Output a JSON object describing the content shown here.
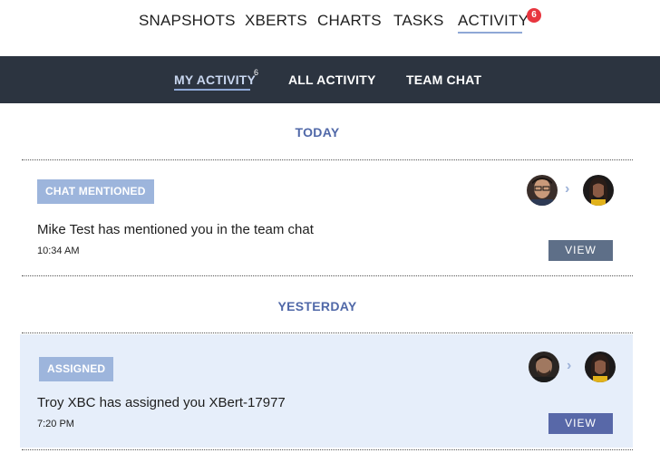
{
  "topnav": {
    "items": [
      "SNAPSHOTS",
      "XBERTS",
      "CHARTS",
      "TASKS",
      "ACTIVITY"
    ],
    "active": "ACTIVITY",
    "activity_badge": "6"
  },
  "subnav": {
    "items": [
      "MY ACTIVITY",
      "ALL ACTIVITY",
      "TEAM CHAT"
    ],
    "active": "MY ACTIVITY",
    "my_activity_count": "6"
  },
  "sections": [
    {
      "day": "TODAY",
      "entries": [
        {
          "tag": "CHAT MENTIONED",
          "message": "Mike Test has mentioned you in the team chat",
          "time": "10:34 AM",
          "button": "VIEW",
          "highlighted": false
        }
      ]
    },
    {
      "day": "YESTERDAY",
      "entries": [
        {
          "tag": "ASSIGNED",
          "message": "Troy XBC has assigned you XBert-17977",
          "time": "7:20 PM",
          "button": "VIEW",
          "highlighted": true
        }
      ]
    }
  ],
  "colors": {
    "subnav_bg": "#2c3440",
    "accent": "#5068a8",
    "tag_bg": "#9db5dc",
    "badge": "#e8363f",
    "highlight_bg": "#e6eefa"
  }
}
